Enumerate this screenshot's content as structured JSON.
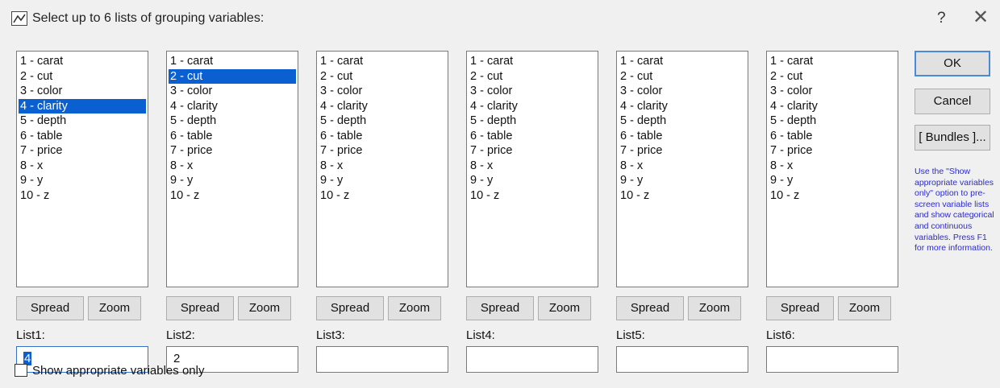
{
  "dialog": {
    "title": "Select up to 6 lists of grouping variables:",
    "help_glyph": "?",
    "close_glyph": "✕",
    "app_icon": "chart-icon"
  },
  "variables": [
    "1 - carat",
    "2 - cut",
    "3 - color",
    "4 - clarity",
    "5 - depth",
    "6 - table",
    "7 - price",
    "8 - x",
    "9 - y",
    "10 - z"
  ],
  "lists": [
    {
      "label": "List1:",
      "value": "4",
      "selected_index": 3,
      "focused": true
    },
    {
      "label": "List2:",
      "value": "2",
      "selected_index": 1,
      "focused": false
    },
    {
      "label": "List3:",
      "value": "",
      "selected_index": -1,
      "focused": false
    },
    {
      "label": "List4:",
      "value": "",
      "selected_index": -1,
      "focused": false
    },
    {
      "label": "List5:",
      "value": "",
      "selected_index": -1,
      "focused": false
    },
    {
      "label": "List6:",
      "value": "",
      "selected_index": -1,
      "focused": false
    }
  ],
  "buttons": {
    "spread": "Spread",
    "zoom": "Zoom",
    "ok": "OK",
    "cancel": "Cancel",
    "bundles": "[ Bundles ]..."
  },
  "help_note": "Use the \"Show appropriate variables only\" option to pre-screen variable lists and show categorical and continuous variables. Press F1 for more information.",
  "checkbox": {
    "label": "Show appropriate variables only",
    "checked": false
  },
  "colors": {
    "selection": "#0a5fd1",
    "help_text": "#2b2bd0",
    "dialog_bg": "#f0f0f0"
  }
}
